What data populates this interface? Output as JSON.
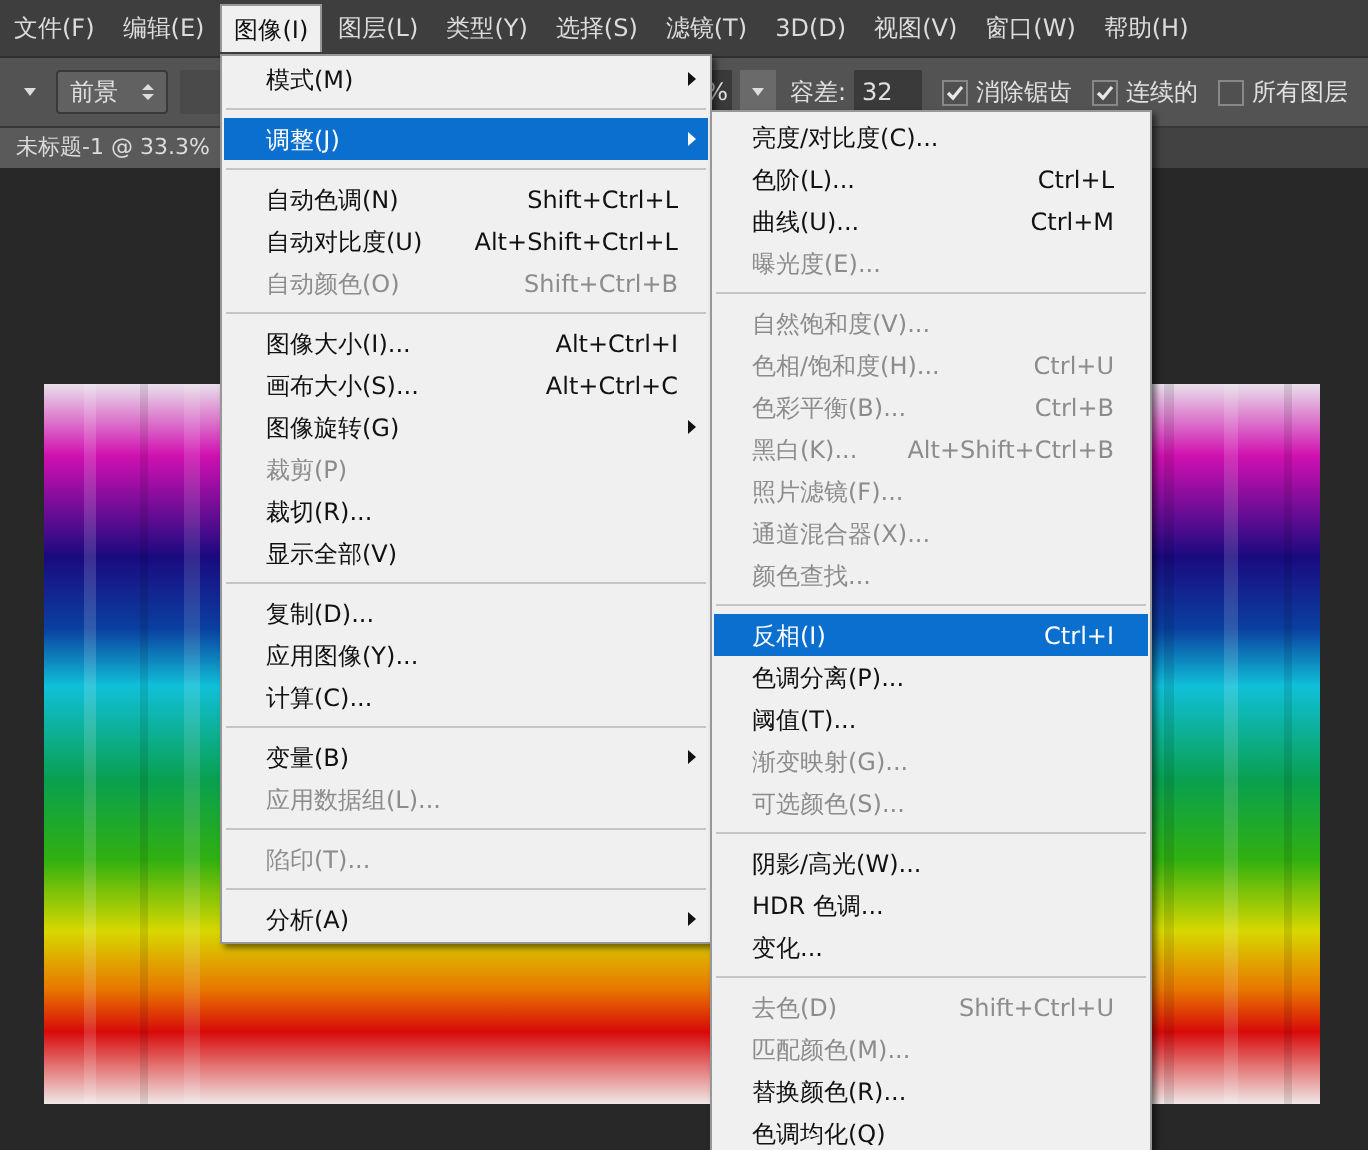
{
  "menu_bar": [
    {
      "label": "文件(F)",
      "selected": false
    },
    {
      "label": "编辑(E)",
      "selected": false
    },
    {
      "label": "图像(I)",
      "selected": true
    },
    {
      "label": "图层(L)",
      "selected": false
    },
    {
      "label": "类型(Y)",
      "selected": false
    },
    {
      "label": "选择(S)",
      "selected": false
    },
    {
      "label": "滤镜(T)",
      "selected": false
    },
    {
      "label": "3D(D)",
      "selected": false
    },
    {
      "label": "视图(V)",
      "selected": false
    },
    {
      "label": "窗口(W)",
      "selected": false
    },
    {
      "label": "帮助(H)",
      "selected": false
    }
  ],
  "options_bar": {
    "preset": "前景",
    "opacity_value": "%",
    "tolerance_label": "容差:",
    "tolerance": "32",
    "checkboxes": [
      {
        "label": "消除锯齿",
        "checked": true
      },
      {
        "label": "连续的",
        "checked": true
      },
      {
        "label": "所有图层",
        "checked": false
      }
    ]
  },
  "document_tab": {
    "title": "未标题-1 @ 33.3%"
  },
  "image_menu": {
    "items": [
      {
        "kind": "item",
        "label": "模式(M)",
        "submenu": true,
        "disabled": false,
        "selected": false
      },
      {
        "kind": "separator"
      },
      {
        "kind": "item",
        "label": "调整(J)",
        "submenu": true,
        "disabled": false,
        "selected": true
      },
      {
        "kind": "separator"
      },
      {
        "kind": "item",
        "label": "自动色调(N)",
        "shortcut": "Shift+Ctrl+L",
        "disabled": false,
        "selected": false
      },
      {
        "kind": "item",
        "label": "自动对比度(U)",
        "shortcut": "Alt+Shift+Ctrl+L",
        "disabled": false,
        "selected": false
      },
      {
        "kind": "item",
        "label": "自动颜色(O)",
        "shortcut": "Shift+Ctrl+B",
        "disabled": true,
        "selected": false
      },
      {
        "kind": "separator"
      },
      {
        "kind": "item",
        "label": "图像大小(I)...",
        "shortcut": "Alt+Ctrl+I",
        "disabled": false,
        "selected": false
      },
      {
        "kind": "item",
        "label": "画布大小(S)...",
        "shortcut": "Alt+Ctrl+C",
        "disabled": false,
        "selected": false
      },
      {
        "kind": "item",
        "label": "图像旋转(G)",
        "submenu": true,
        "disabled": false,
        "selected": false
      },
      {
        "kind": "item",
        "label": "裁剪(P)",
        "disabled": true,
        "selected": false
      },
      {
        "kind": "item",
        "label": "裁切(R)...",
        "disabled": false,
        "selected": false
      },
      {
        "kind": "item",
        "label": "显示全部(V)",
        "disabled": false,
        "selected": false
      },
      {
        "kind": "separator"
      },
      {
        "kind": "item",
        "label": "复制(D)...",
        "disabled": false,
        "selected": false
      },
      {
        "kind": "item",
        "label": "应用图像(Y)...",
        "disabled": false,
        "selected": false
      },
      {
        "kind": "item",
        "label": "计算(C)...",
        "disabled": false,
        "selected": false
      },
      {
        "kind": "separator"
      },
      {
        "kind": "item",
        "label": "变量(B)",
        "submenu": true,
        "disabled": false,
        "selected": false
      },
      {
        "kind": "item",
        "label": "应用数据组(L)...",
        "disabled": true,
        "selected": false
      },
      {
        "kind": "separator"
      },
      {
        "kind": "item",
        "label": "陷印(T)...",
        "disabled": true,
        "selected": false
      },
      {
        "kind": "separator"
      },
      {
        "kind": "item",
        "label": "分析(A)",
        "submenu": true,
        "disabled": false,
        "selected": false
      }
    ]
  },
  "adjust_submenu": {
    "items": [
      {
        "kind": "item",
        "label": "亮度/对比度(C)...",
        "disabled": false,
        "selected": false
      },
      {
        "kind": "item",
        "label": "色阶(L)...",
        "shortcut": "Ctrl+L",
        "disabled": false,
        "selected": false
      },
      {
        "kind": "item",
        "label": "曲线(U)...",
        "shortcut": "Ctrl+M",
        "disabled": false,
        "selected": false
      },
      {
        "kind": "item",
        "label": "曝光度(E)...",
        "disabled": true,
        "selected": false
      },
      {
        "kind": "separator"
      },
      {
        "kind": "item",
        "label": "自然饱和度(V)...",
        "disabled": true,
        "selected": false
      },
      {
        "kind": "item",
        "label": "色相/饱和度(H)...",
        "shortcut": "Ctrl+U",
        "disabled": true,
        "selected": false
      },
      {
        "kind": "item",
        "label": "色彩平衡(B)...",
        "shortcut": "Ctrl+B",
        "disabled": true,
        "selected": false
      },
      {
        "kind": "item",
        "label": "黑白(K)...",
        "shortcut": "Alt+Shift+Ctrl+B",
        "disabled": true,
        "selected": false
      },
      {
        "kind": "item",
        "label": "照片滤镜(F)...",
        "disabled": true,
        "selected": false
      },
      {
        "kind": "item",
        "label": "通道混合器(X)...",
        "disabled": true,
        "selected": false
      },
      {
        "kind": "item",
        "label": "颜色查找...",
        "disabled": true,
        "selected": false
      },
      {
        "kind": "separator"
      },
      {
        "kind": "item",
        "label": "反相(I)",
        "shortcut": "Ctrl+I",
        "disabled": false,
        "selected": true
      },
      {
        "kind": "item",
        "label": "色调分离(P)...",
        "disabled": false,
        "selected": false
      },
      {
        "kind": "item",
        "label": "阈值(T)...",
        "disabled": false,
        "selected": false
      },
      {
        "kind": "item",
        "label": "渐变映射(G)...",
        "disabled": true,
        "selected": false
      },
      {
        "kind": "item",
        "label": "可选颜色(S)...",
        "disabled": true,
        "selected": false
      },
      {
        "kind": "separator"
      },
      {
        "kind": "item",
        "label": "阴影/高光(W)...",
        "disabled": false,
        "selected": false
      },
      {
        "kind": "item",
        "label": "HDR 色调...",
        "disabled": false,
        "selected": false
      },
      {
        "kind": "item",
        "label": "变化...",
        "disabled": false,
        "selected": false
      },
      {
        "kind": "separator"
      },
      {
        "kind": "item",
        "label": "去色(D)",
        "shortcut": "Shift+Ctrl+U",
        "disabled": true,
        "selected": false
      },
      {
        "kind": "item",
        "label": "匹配颜色(M)...",
        "disabled": true,
        "selected": false
      },
      {
        "kind": "item",
        "label": "替换颜色(R)...",
        "disabled": false,
        "selected": false
      },
      {
        "kind": "item",
        "label": "色调均化(Q)",
        "disabled": false,
        "selected": false
      }
    ]
  }
}
